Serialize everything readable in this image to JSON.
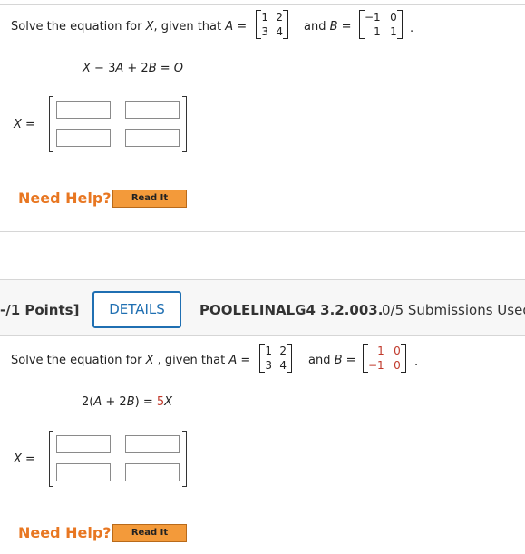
{
  "problem1": {
    "prompt_pre": "Solve the equation for ",
    "prompt_var": "X",
    "prompt_mid": ", given that ",
    "a_label": "A",
    "equals": " =",
    "and_text": "and ",
    "b_label": "B",
    "period": ".",
    "matrix_a": [
      "1",
      "2",
      "3",
      "4"
    ],
    "matrix_b": [
      "−1",
      "0",
      "1",
      "1"
    ],
    "equation": {
      "p1": "X",
      "p2": " − 3",
      "p3": "A",
      "p4": " + 2",
      "p5": "B",
      "p6": " = ",
      "p7": "O"
    },
    "x_label": "X =",
    "need_help": "Need Help?",
    "read_it": "Read It"
  },
  "problem2": {
    "points": "-/1 Points]",
    "details": "DETAILS",
    "code": "POOLELINALG4 3.2.003.",
    "submissions": "0/5 Submissions Used",
    "prompt_pre": "Solve the equation for ",
    "prompt_var": "X",
    "prompt_mid": " , given that ",
    "a_label": "A",
    "equals": " =",
    "and_text": "and ",
    "b_label": "B",
    "period": ".",
    "matrix_a": [
      "1",
      "2",
      "3",
      "4"
    ],
    "matrix_b": [
      "1",
      "0",
      "−1",
      "0"
    ],
    "equation": {
      "p1": "2(",
      "p2": "A",
      "p3": " + 2",
      "p4": "B",
      "p5": ") = ",
      "p6": "5",
      "p7": "X"
    },
    "x_label": "X =",
    "need_help": "Need Help?",
    "read_it": "Read It"
  },
  "colors": {
    "accent_blue": "#1f6fb2",
    "help_orange": "#e87722",
    "button_orange": "#f39a3a",
    "red_entry": "#c0392b"
  }
}
